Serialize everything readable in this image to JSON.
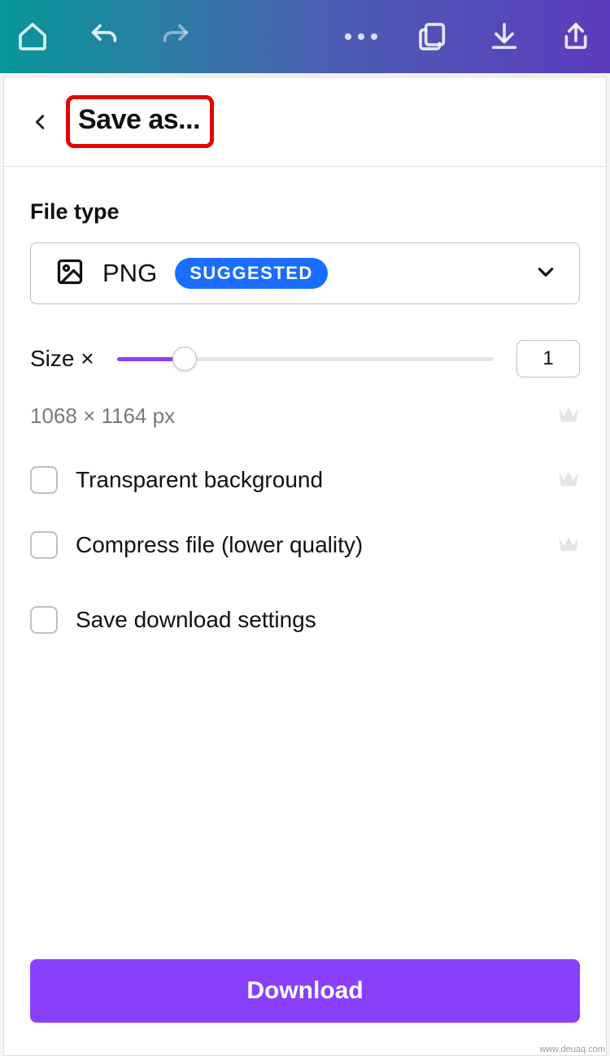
{
  "header": {
    "title": "Save as..."
  },
  "file_type": {
    "section_label": "File type",
    "selected": "PNG",
    "badge": "SUGGESTED"
  },
  "size": {
    "label": "Size ×",
    "value": "1",
    "dimensions": "1068 × 1164 px"
  },
  "options": {
    "transparent_bg": "Transparent background",
    "compress": "Compress file (lower quality)",
    "save_settings": "Save download settings"
  },
  "actions": {
    "download": "Download"
  },
  "watermark": "www.deuaq.com"
}
